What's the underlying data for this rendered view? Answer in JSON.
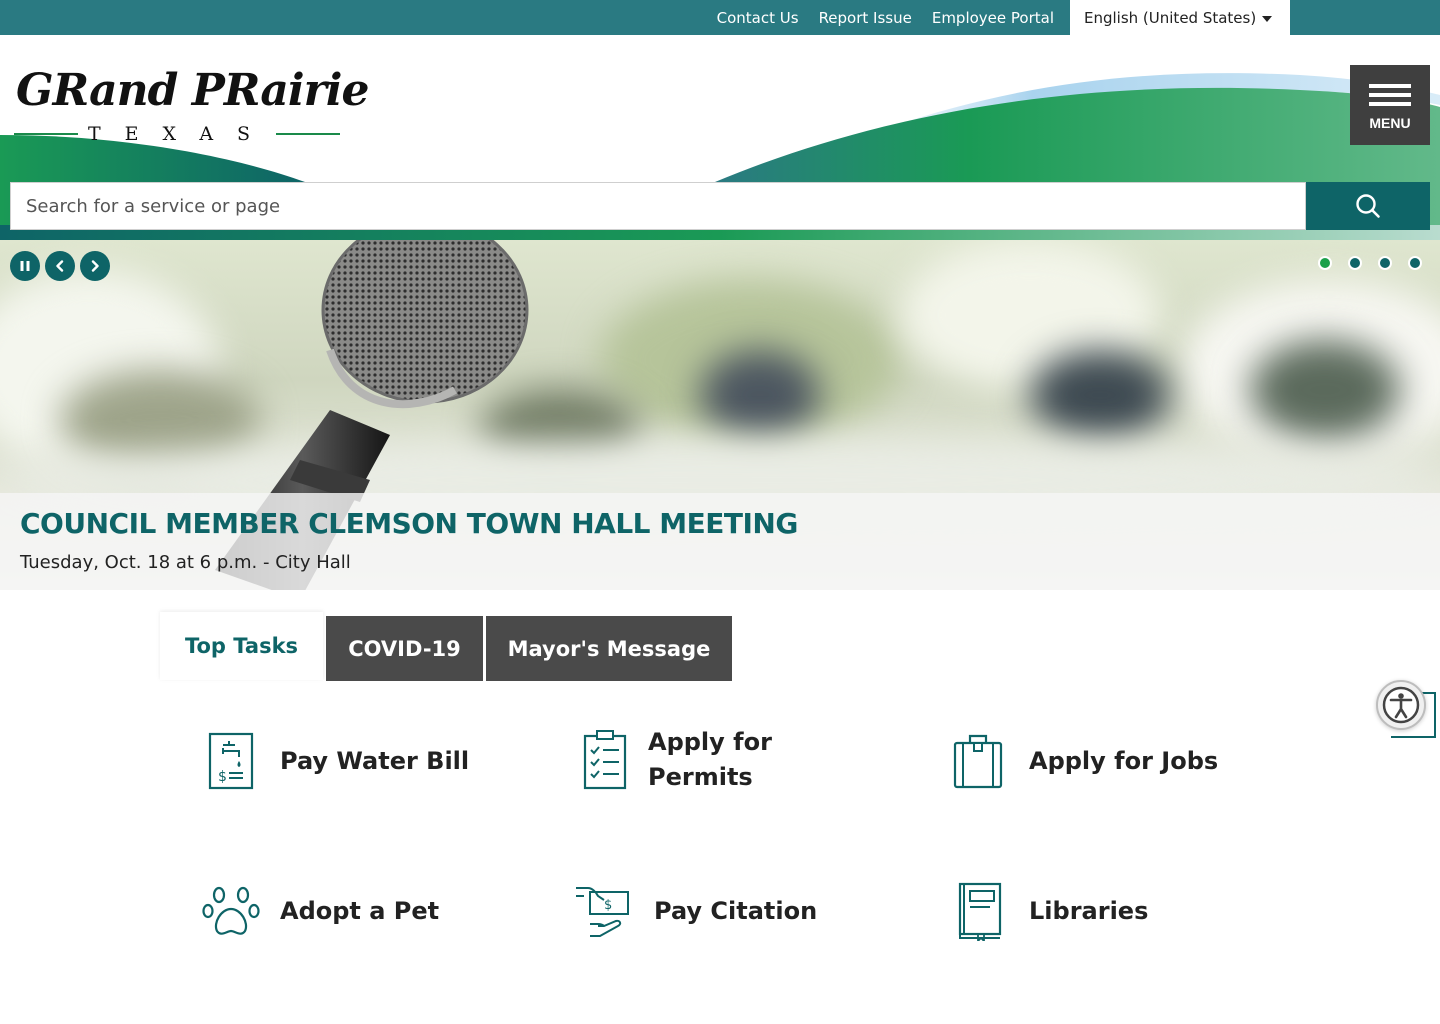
{
  "topbar": {
    "links": [
      "Contact Us",
      "Report Issue",
      "Employee Portal"
    ],
    "language": "English (United States)"
  },
  "header": {
    "logo_script": "GRand PRairie",
    "logo_sub": "TEXAS",
    "menu_label": "MENU"
  },
  "search": {
    "placeholder": "Search for a service or page"
  },
  "hero": {
    "title": "COUNCIL MEMBER CLEMSON TOWN HALL MEETING",
    "subtitle": "Tuesday, Oct. 18 at 6 p.m. - City Hall",
    "slide_count": 4,
    "active_slide": 1
  },
  "tabs": [
    {
      "label": "Top Tasks",
      "active": true
    },
    {
      "label": "COVID-19",
      "active": false
    },
    {
      "label": "Mayor's Message",
      "active": false
    }
  ],
  "tasks": [
    {
      "label": "Pay Water Bill",
      "icon": "water-bill-icon"
    },
    {
      "label": "Apply for Permits",
      "icon": "checklist-icon"
    },
    {
      "label": "Apply for Jobs",
      "icon": "briefcase-icon"
    },
    {
      "label": "Adopt a Pet",
      "icon": "paw-icon"
    },
    {
      "label": "Pay Citation",
      "icon": "payment-icon"
    },
    {
      "label": "Libraries",
      "icon": "book-icon"
    }
  ],
  "colors": {
    "teal": "#2a7a82",
    "dark_teal": "#0e6467",
    "green": "#1aa04a",
    "tab_dark": "#4a4a4a"
  }
}
